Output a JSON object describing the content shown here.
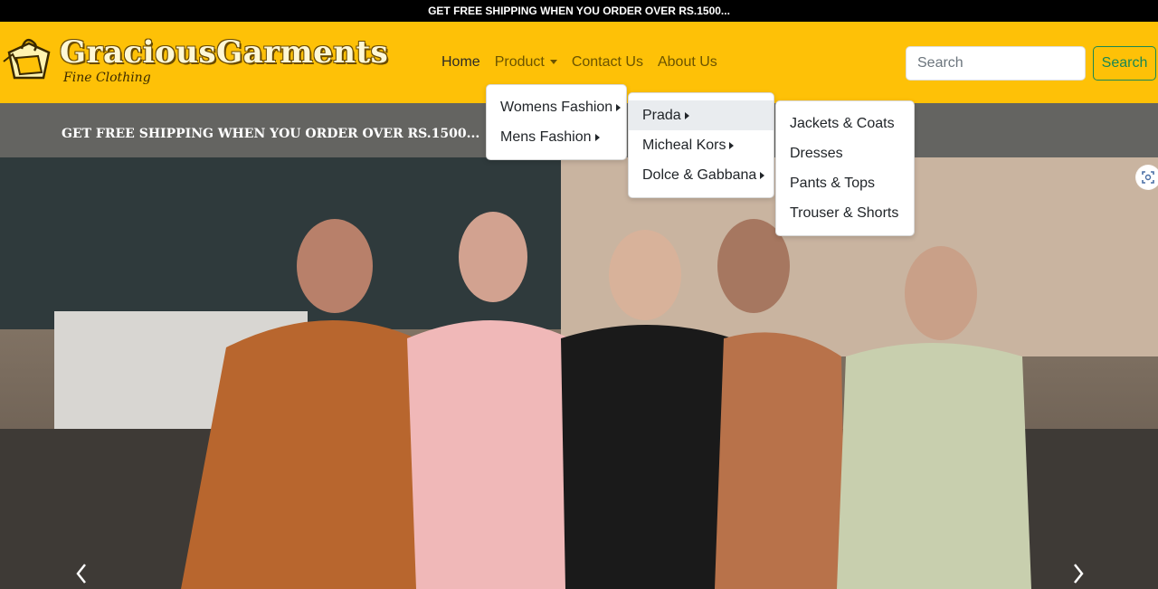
{
  "top_bar": {
    "text": "GET FREE SHIPPING WHEN YOU ORDER OVER RS.1500..."
  },
  "brand": {
    "title": "GraciousGarments",
    "tagline": "Fine Clothing"
  },
  "nav": {
    "home": "Home",
    "product": "Product",
    "contact": "Contact Us",
    "about": "About Us"
  },
  "search": {
    "placeholder": "Search",
    "button": "Search"
  },
  "promo": {
    "text": "GET FREE SHIPPING WHEN YOU ORDER OVER RS.1500..."
  },
  "menus": {
    "level1": [
      "Womens Fashion",
      "Mens Fashion"
    ],
    "level2": [
      "Prada",
      "Micheal Kors",
      "Dolce & Gabbana"
    ],
    "level3": [
      "Jackets & Coats",
      "Dresses",
      "Pants & Tops",
      "Trouser & Shorts"
    ]
  },
  "colors": {
    "navbar_bg": "#fec107",
    "top_bar_bg": "#000000",
    "promo_band_bg": "#646461",
    "search_button": "#198754"
  },
  "icons": {
    "logo": "shopping-bag-icon",
    "expand": "expand-icon",
    "prev": "chevron-left-icon",
    "next": "chevron-right-icon"
  }
}
